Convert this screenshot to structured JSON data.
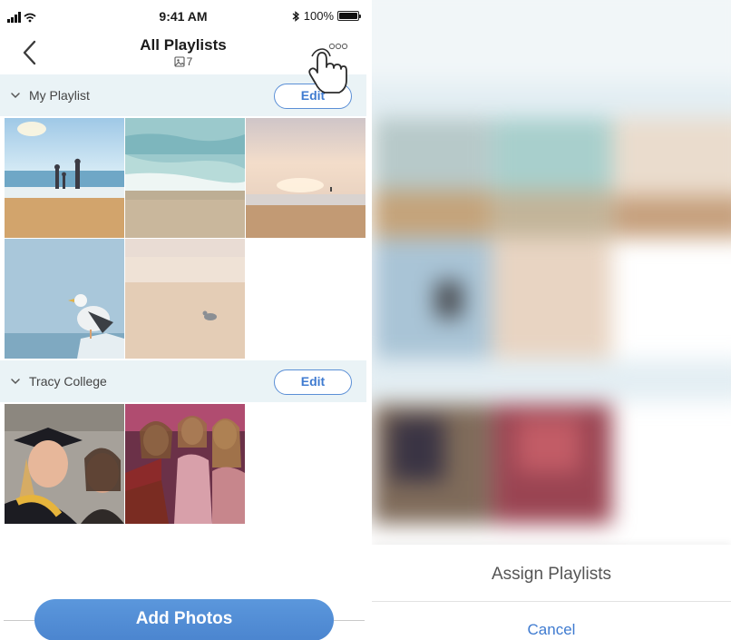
{
  "status_bar": {
    "time": "9:41 AM",
    "battery": "100%",
    "battery_level": 1.0
  },
  "nav": {
    "title": "All Playlists",
    "photo_count": "7",
    "back_icon": "chevron-left-icon",
    "more_icon": "more-dots-icon"
  },
  "sections": [
    {
      "title": "My Playlist",
      "edit_label": "Edit",
      "photos": [
        {
          "name": "family-at-beach-photo"
        },
        {
          "name": "ocean-wave-photo"
        },
        {
          "name": "beach-sunset-photo"
        },
        {
          "name": "seagull-on-post-photo"
        },
        {
          "name": "bird-on-sand-photo"
        }
      ]
    },
    {
      "title": "Tracy College",
      "edit_label": "Edit",
      "photos": [
        {
          "name": "graduation-photo"
        },
        {
          "name": "friends-selfie-photo"
        }
      ]
    }
  ],
  "add_photos_label": "Add Photos",
  "action_sheet": {
    "assign_label": "Assign Playlists",
    "cancel_label": "Cancel"
  },
  "colors": {
    "accent": "#4b85cf",
    "section_bg": "#eaf3f6",
    "cancel": "#3f7bd0"
  }
}
